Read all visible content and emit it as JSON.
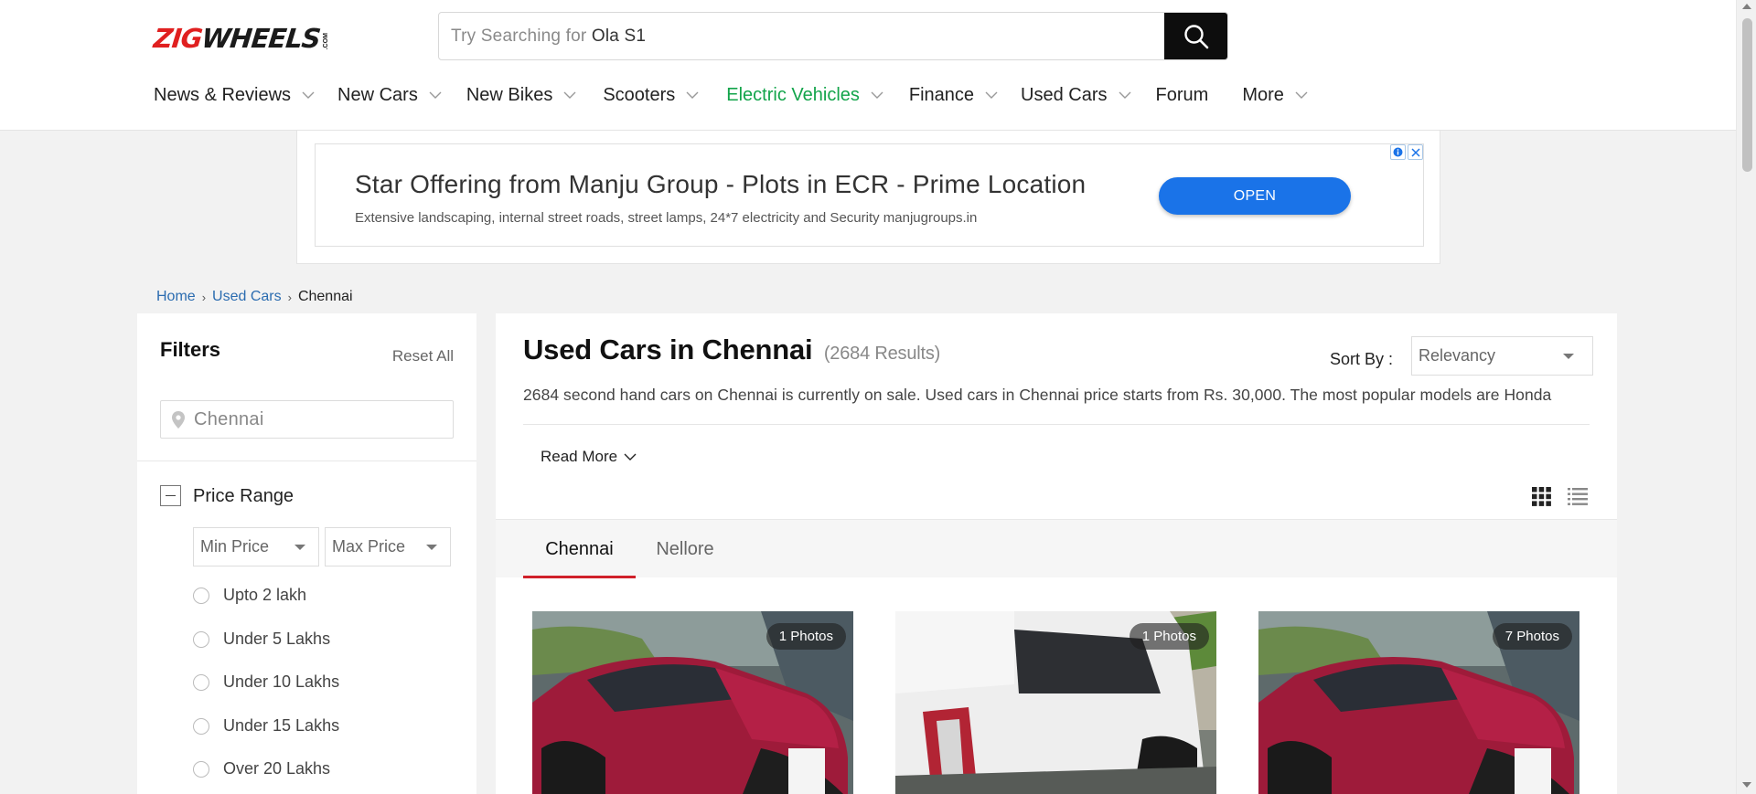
{
  "header": {
    "logo": {
      "zig": "ZIG",
      "wheels": "WHEELS",
      "com": ".COM"
    },
    "search": {
      "prefix": "Try Searching for ",
      "suggestion": "Ola S1",
      "icon": "search-icon"
    },
    "nav": [
      {
        "label": "News & Reviews"
      },
      {
        "label": "New Cars"
      },
      {
        "label": "New Bikes"
      },
      {
        "label": "Scooters"
      },
      {
        "label": "Electric Vehicles"
      },
      {
        "label": "Finance"
      },
      {
        "label": "Used Cars"
      },
      {
        "label": "Forum"
      },
      {
        "label": "More"
      }
    ],
    "accent_green": "#12a44a"
  },
  "ad": {
    "title": "Star Offering from Manju Group - Plots in ECR - Prime Location",
    "description": "Extensive landscaping, internal street roads, street lamps, 24*7 electricity and Security manjugroups.in",
    "cta": "OPEN",
    "cta_color": "#1a73e8"
  },
  "breadcrumb": {
    "home": "Home",
    "used_cars": "Used Cars",
    "current": "Chennai"
  },
  "filters": {
    "title": "Filters",
    "reset": "Reset All",
    "location_value": "Chennai",
    "price_range": {
      "title": "Price Range",
      "min_placeholder": "Min Price",
      "max_placeholder": "Max Price",
      "options": [
        "Upto 2 lakh",
        "Under 5 Lakhs",
        "Under 10 Lakhs",
        "Under 15 Lakhs",
        "Over 20 Lakhs"
      ]
    }
  },
  "main": {
    "title": "Used Cars in Chennai",
    "results": "(2684 Results)",
    "sort_label": "Sort By :",
    "sort_value": "Relevancy",
    "description": "2684 second hand cars on Chennai is currently on sale. Used cars in Chennai price starts from Rs. 30,000. The most popular models are Honda",
    "read_more": "Read More",
    "tabs": [
      "Chennai",
      "Nellore"
    ],
    "tab_accent": "#d0202a",
    "cards": [
      {
        "photos": "1 Photos",
        "color": "red"
      },
      {
        "photos": "1 Photos",
        "color": "white"
      },
      {
        "photos": "7 Photos",
        "color": "red"
      }
    ]
  }
}
